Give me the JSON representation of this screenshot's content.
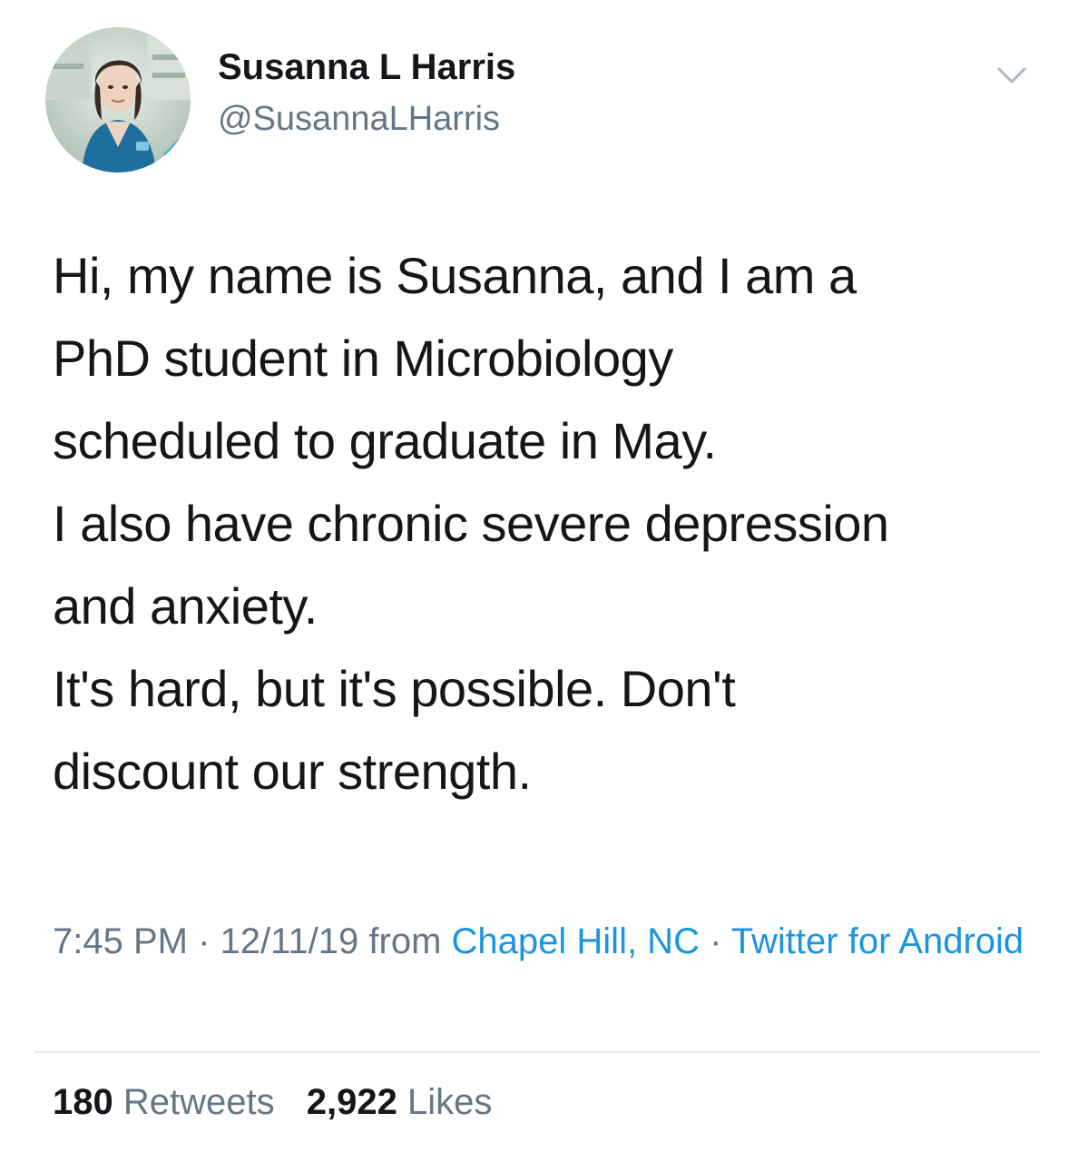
{
  "author": {
    "display_name": "Susanna L Harris",
    "handle": "@SusannaLHarris",
    "avatar_icon": "profile-photo"
  },
  "tweet": {
    "lines": [
      "Hi, my name is Susanna, and I am a",
      "PhD student in Microbiology",
      "scheduled to graduate in May.",
      "I also have chronic severe depression",
      "and anxiety.",
      "It's hard, but it's possible. Don't",
      "discount our strength."
    ]
  },
  "meta": {
    "time": "7:45 PM",
    "separator": "·",
    "date": "12/11/19",
    "from_label": "from",
    "location": "Chapel Hill, NC",
    "client": "Twitter for Android"
  },
  "stats": {
    "retweets_count": "180",
    "retweets_label": "Retweets",
    "likes_count": "2,922",
    "likes_label": "Likes"
  },
  "colors": {
    "text": "#14171a",
    "secondary": "#657786",
    "link": "#1b95e0",
    "divider": "#e1e8ed"
  },
  "icons": {
    "menu": "chevron-down-icon"
  }
}
